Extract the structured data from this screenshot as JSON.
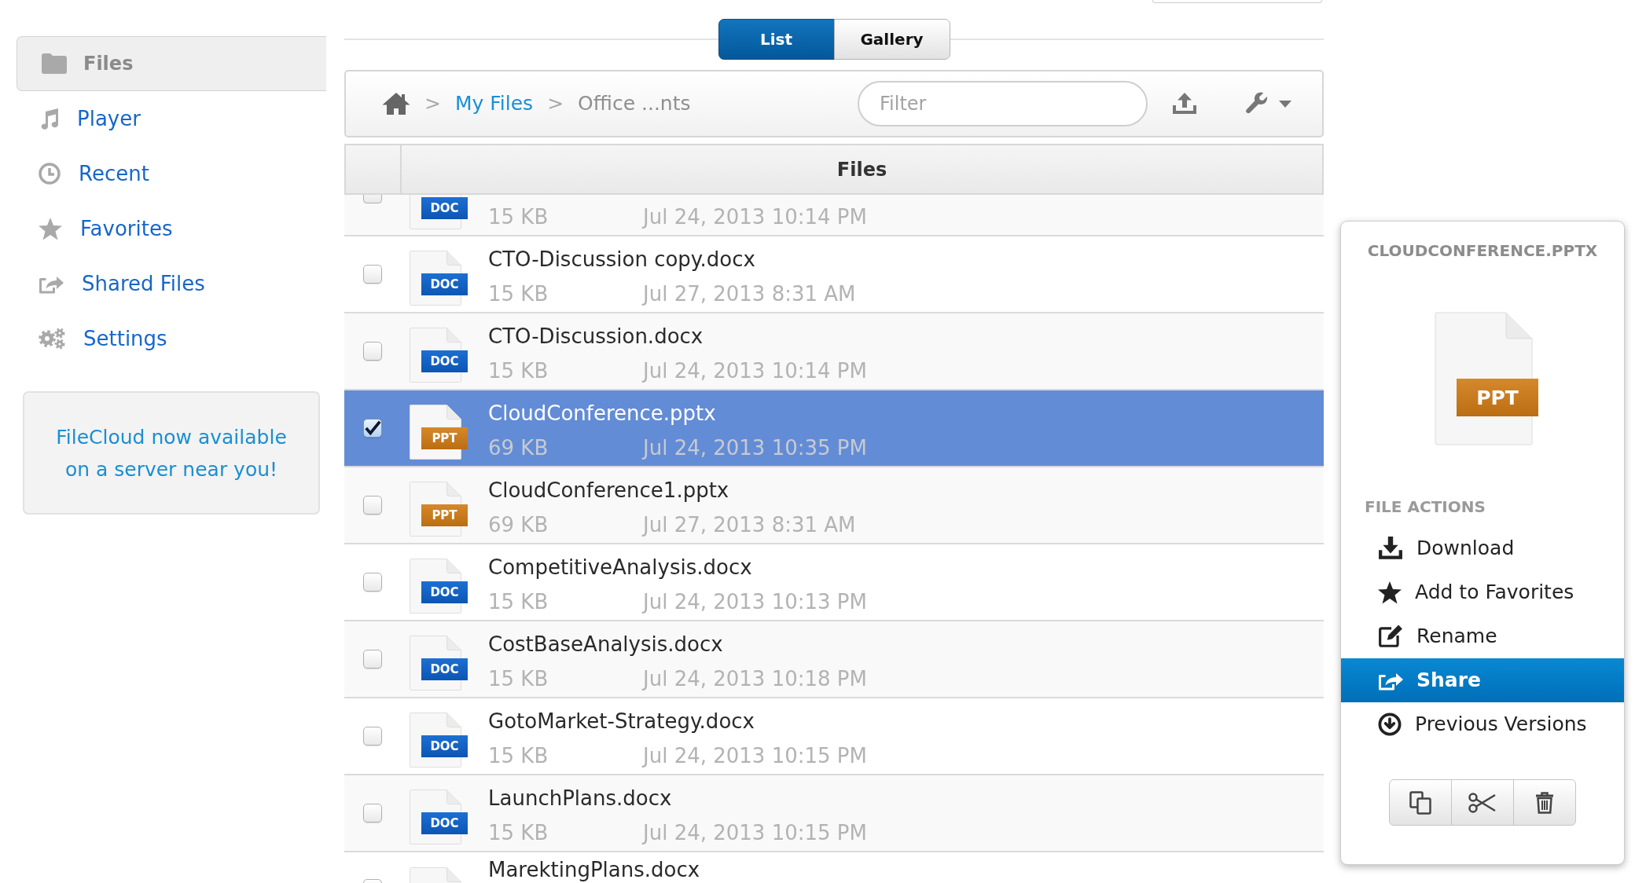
{
  "sidebar": {
    "items": [
      {
        "label": "Files",
        "selected": true
      },
      {
        "label": "Player",
        "selected": false
      },
      {
        "label": "Recent",
        "selected": false
      },
      {
        "label": "Favorites",
        "selected": false
      },
      {
        "label": "Shared Files",
        "selected": false
      },
      {
        "label": "Settings",
        "selected": false
      }
    ],
    "promo": "FileCloud now available on a server near you!"
  },
  "view_toggle": [
    {
      "label": "List",
      "selected": true
    },
    {
      "label": "Gallery",
      "selected": false
    }
  ],
  "breadcrumb": [
    {
      "kind": "separator",
      "label": ">"
    },
    {
      "kind": "link",
      "label": "My Files"
    },
    {
      "kind": "separator",
      "label": ">"
    },
    {
      "kind": "current",
      "label": "Office ...nts"
    }
  ],
  "filter": {
    "placeholder": "Filter"
  },
  "table": {
    "header": "Files",
    "rows": [
      {
        "kind": "doc",
        "badge": "DOC",
        "size": "15 KB",
        "date": "Jul 24, 2013 10:14 PM",
        "checked": false,
        "selected": false
      },
      {
        "kind": "doc",
        "badge": "DOC",
        "name": "CTO-Discussion copy.docx",
        "size": "15 KB",
        "date": "Jul 27, 2013 8:31 AM",
        "checked": false,
        "selected": false
      },
      {
        "kind": "doc",
        "badge": "DOC",
        "name": "CTO-Discussion.docx",
        "size": "15 KB",
        "date": "Jul 24, 2013 10:14 PM",
        "checked": false,
        "selected": false
      },
      {
        "kind": "ppt",
        "badge": "PPT",
        "name": "CloudConference.pptx",
        "size": "69 KB",
        "date": "Jul 24, 2013 10:35 PM",
        "checked": true,
        "selected": true
      },
      {
        "kind": "ppt",
        "badge": "PPT",
        "name": "CloudConference1.pptx",
        "size": "69 KB",
        "date": "Jul 27, 2013 8:31 AM",
        "checked": false,
        "selected": false
      },
      {
        "kind": "doc",
        "badge": "DOC",
        "name": "CompetitiveAnalysis.docx",
        "size": "15 KB",
        "date": "Jul 24, 2013 10:13 PM",
        "checked": false,
        "selected": false
      },
      {
        "kind": "doc",
        "badge": "DOC",
        "name": "CostBaseAnalysis.docx",
        "size": "15 KB",
        "date": "Jul 24, 2013 10:18 PM",
        "checked": false,
        "selected": false
      },
      {
        "kind": "doc",
        "badge": "DOC",
        "name": "GotoMarket-Strategy.docx",
        "size": "15 KB",
        "date": "Jul 24, 2013 10:15 PM",
        "checked": false,
        "selected": false
      },
      {
        "kind": "doc",
        "badge": "DOC",
        "name": "LaunchPlans.docx",
        "size": "15 KB",
        "date": "Jul 24, 2013 10:15 PM",
        "checked": false,
        "selected": false
      },
      {
        "name": "MarektingPlans.docx",
        "checked": false,
        "selected": false
      }
    ]
  },
  "details": {
    "title": "CLOUDCONFERENCE.PPTX",
    "preview": {
      "kind": "ppt",
      "badge": "PPT"
    },
    "section_title": "FILE ACTIONS",
    "actions": [
      {
        "label": "Download",
        "selected": false
      },
      {
        "label": "Add to Favorites",
        "selected": false
      },
      {
        "label": "Rename",
        "selected": false
      },
      {
        "label": "Share",
        "selected": true
      },
      {
        "label": "Previous Versions",
        "selected": false
      }
    ]
  }
}
